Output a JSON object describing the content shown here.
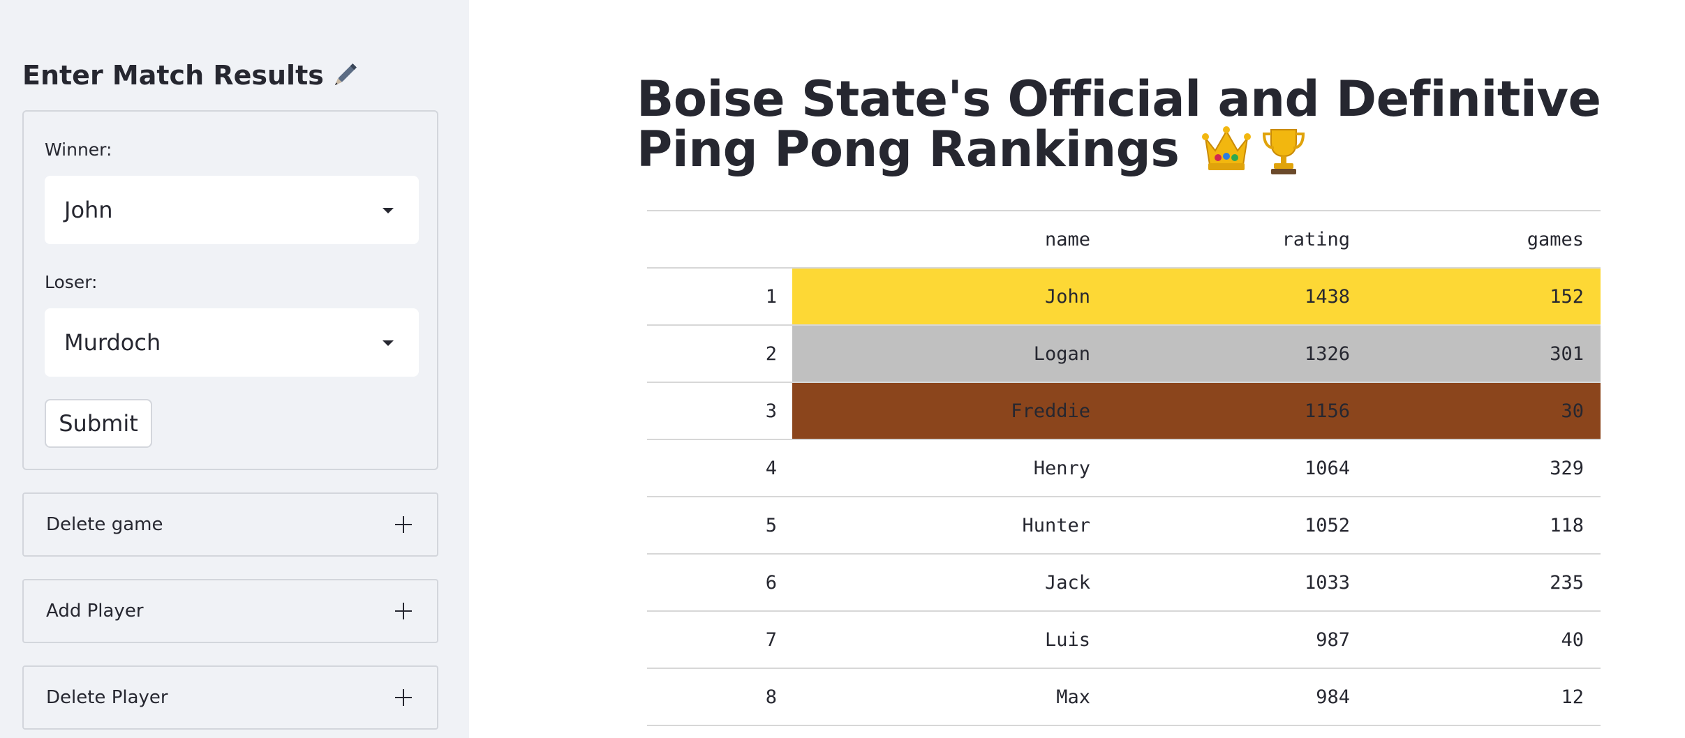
{
  "sidebar": {
    "heading": "Enter Match Results",
    "heading_icon": "pencil-icon",
    "winner_label": "Winner:",
    "winner_value": "John",
    "loser_label": "Loser:",
    "loser_value": "Murdoch",
    "submit_label": "Submit",
    "expanders": [
      {
        "label": "Delete game"
      },
      {
        "label": "Add Player"
      },
      {
        "label": "Delete Player"
      }
    ]
  },
  "main": {
    "title": "Boise State's Official and Definitive Ping Pong Rankings",
    "title_icons": [
      "crown-icon",
      "trophy-icon"
    ]
  },
  "table": {
    "columns": [
      "",
      "name",
      "rating",
      "games"
    ],
    "rows": [
      {
        "index": "1",
        "name": "John",
        "rating": "1438",
        "games": "152",
        "highlight": "#fdd835"
      },
      {
        "index": "2",
        "name": "Logan",
        "rating": "1326",
        "games": "301",
        "highlight": "#c0c0c0"
      },
      {
        "index": "3",
        "name": "Freddie",
        "rating": "1156",
        "games": "30",
        "highlight": "#8b451c"
      },
      {
        "index": "4",
        "name": "Henry",
        "rating": "1064",
        "games": "329",
        "highlight": ""
      },
      {
        "index": "5",
        "name": "Hunter",
        "rating": "1052",
        "games": "118",
        "highlight": ""
      },
      {
        "index": "6",
        "name": "Jack",
        "rating": "1033",
        "games": "235",
        "highlight": ""
      },
      {
        "index": "7",
        "name": "Luis",
        "rating": "987",
        "games": "40",
        "highlight": ""
      },
      {
        "index": "8",
        "name": "Max",
        "rating": "984",
        "games": "12",
        "highlight": ""
      }
    ]
  }
}
